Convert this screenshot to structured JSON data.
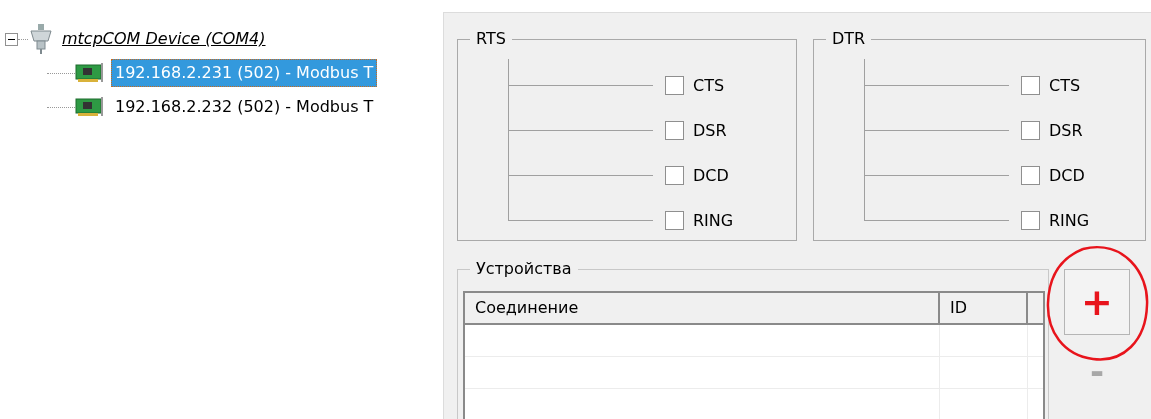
{
  "tree": {
    "label": "mtcpCOM Device (COM4)",
    "expanded": true,
    "children": [
      {
        "label": "192.168.2.231 (502) - Modbus T",
        "selected": true
      },
      {
        "label": "192.168.2.232 (502) - Modbus T",
        "selected": false
      }
    ]
  },
  "signal_groups": [
    {
      "title": "RTS",
      "lines": [
        {
          "label": "CTS",
          "checked": false
        },
        {
          "label": "DSR",
          "checked": false
        },
        {
          "label": "DCD",
          "checked": false
        },
        {
          "label": "RING",
          "checked": false
        }
      ]
    },
    {
      "title": "DTR",
      "lines": [
        {
          "label": "CTS",
          "checked": false
        },
        {
          "label": "DSR",
          "checked": false
        },
        {
          "label": "DCD",
          "checked": false
        },
        {
          "label": "RING",
          "checked": false
        }
      ]
    }
  ],
  "devices": {
    "title": "Устройства",
    "columns": [
      "Соединение",
      "ID"
    ]
  },
  "buttons": [
    {
      "kind": "add",
      "label": "+",
      "disabled": false
    },
    {
      "kind": "remove",
      "label": "-",
      "disabled": true
    }
  ]
}
